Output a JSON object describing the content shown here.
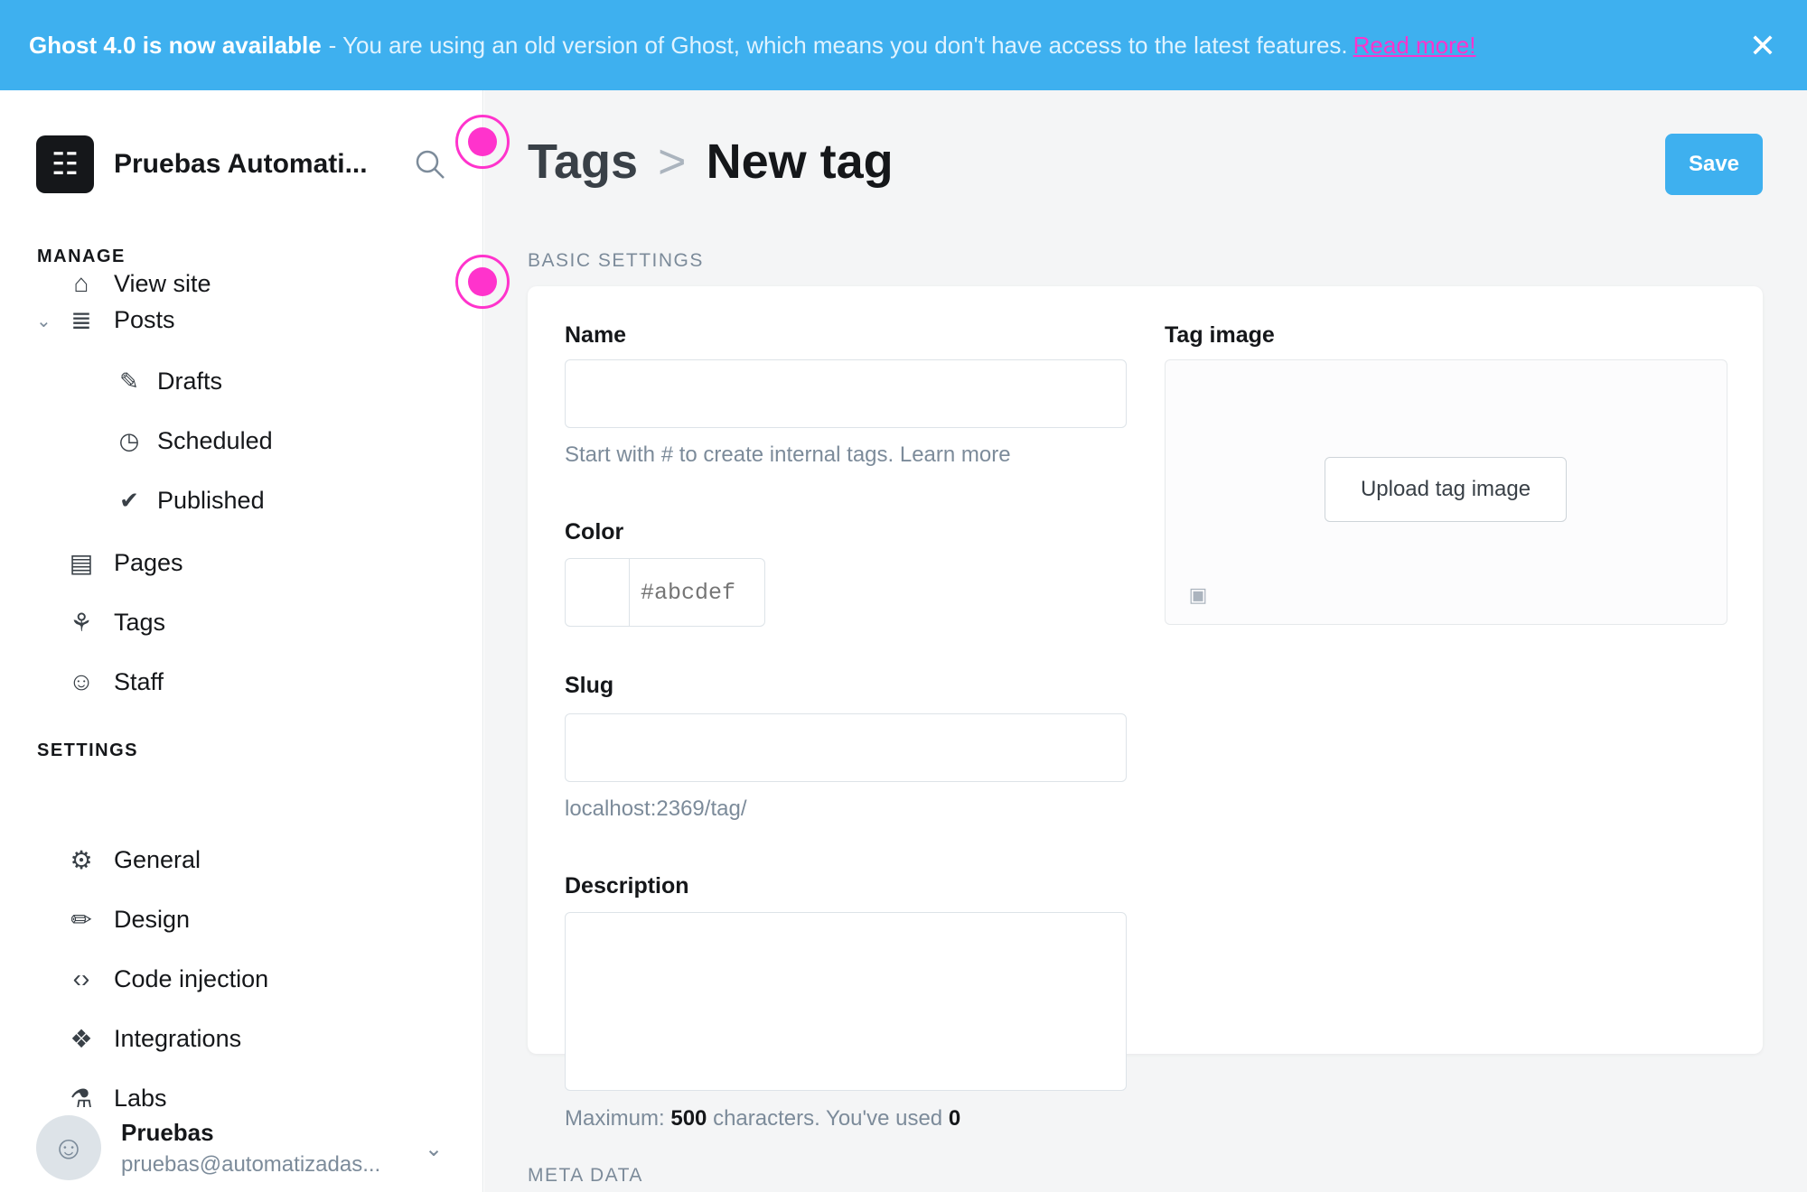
{
  "banner": {
    "strong": "Ghost 4.0 is now available",
    "message": "- You are using an old version of Ghost, which means you don't have access to the latest features.",
    "link": "Read more!",
    "close_icon": "close-icon"
  },
  "sidebar": {
    "site_title": "Pruebas Automati...",
    "logo_glyph": "☷",
    "search_icon": "search-icon",
    "manage_heading": "MANAGE",
    "settings_heading": "SETTINGS",
    "items": [
      {
        "label": "View site",
        "icon": "home-icon",
        "glyph": "⌂"
      },
      {
        "label": "Posts",
        "icon": "posts-icon",
        "glyph": "≣"
      },
      {
        "label": "Pages",
        "icon": "pages-icon",
        "glyph": "▤"
      },
      {
        "label": "Tags",
        "icon": "tag-icon",
        "glyph": "⚘"
      },
      {
        "label": "Staff",
        "icon": "staff-icon",
        "glyph": "☺"
      }
    ],
    "post_subitems": [
      {
        "label": "Drafts",
        "icon": "pencil-icon",
        "glyph": "✎"
      },
      {
        "label": "Scheduled",
        "icon": "clock-icon",
        "glyph": "◷"
      },
      {
        "label": "Published",
        "icon": "published-icon",
        "glyph": "✔"
      }
    ],
    "settings_items": [
      {
        "label": "General",
        "icon": "gear-icon",
        "glyph": "⚙"
      },
      {
        "label": "Design",
        "icon": "brush-icon",
        "glyph": "✏"
      },
      {
        "label": "Code injection",
        "icon": "code-icon",
        "glyph": "‹›"
      },
      {
        "label": "Integrations",
        "icon": "integrations-icon",
        "glyph": "❖"
      },
      {
        "label": "Labs",
        "icon": "flask-icon",
        "glyph": "⚗"
      }
    ],
    "user": {
      "name": "Pruebas",
      "email": "pruebas@automatizadas..."
    }
  },
  "header": {
    "breadcrumb": "Tags",
    "separator": ">",
    "current": "New tag",
    "save_label": "Save"
  },
  "basic_settings": {
    "heading": "BASIC SETTINGS",
    "name_label": "Name",
    "name_value": "",
    "name_hint": "Start with # to create internal tags. Learn more",
    "color_label": "Color",
    "color_placeholder": "#abcdef",
    "slug_label": "Slug",
    "slug_value": "",
    "slug_hint": "localhost:2369/tag/",
    "description_label": "Description",
    "description_value": "",
    "description_hint_prefix": "Maximum:",
    "description_max": "500",
    "description_hint_mid": "characters. You've used",
    "description_used": "0",
    "tag_image_label": "Tag image",
    "upload_label": "Upload tag image",
    "unsplash_icon": "unsplash-icon"
  },
  "meta_data": {
    "heading": "META DATA"
  },
  "colors": {
    "accent": "#3eb0ef",
    "indicator": "#ff33cc"
  }
}
